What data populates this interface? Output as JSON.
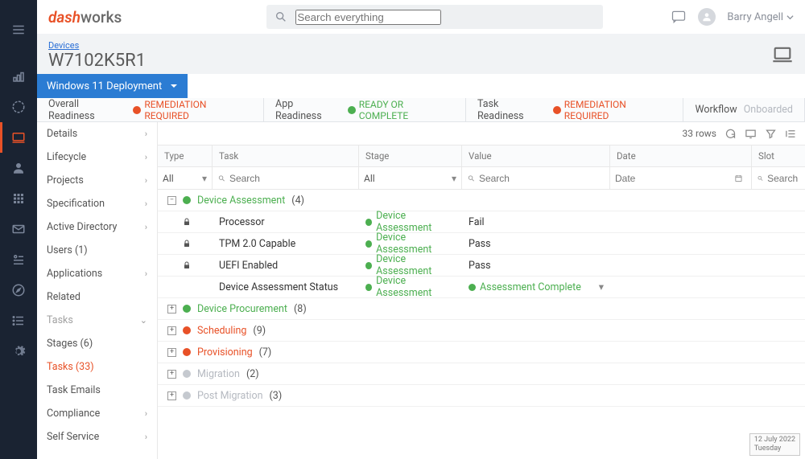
{
  "logo": {
    "prefix": "dash",
    "suffix": "works"
  },
  "search": {
    "placeholder": "Search everything"
  },
  "user": {
    "name": "Barry Angell"
  },
  "breadcrumb": {
    "parent": "Devices",
    "title": "W7102K5R1"
  },
  "deployment_dropdown": "Windows 11 Deployment",
  "tabs": [
    {
      "label": "Overall Readiness",
      "status_text": "REMEDIATION REQUIRED",
      "status_color": "red"
    },
    {
      "label": "App Readiness",
      "status_text": "READY OR COMPLETE",
      "status_color": "green"
    },
    {
      "label": "Task Readiness",
      "status_text": "REMEDIATION REQUIRED",
      "status_color": "red"
    },
    {
      "label": "Workflow",
      "muted_label": "Onboarded"
    }
  ],
  "sidebar": {
    "items": [
      {
        "label": "Details",
        "chevron": true
      },
      {
        "label": "Lifecycle",
        "chevron": true
      },
      {
        "label": "Projects",
        "chevron": true
      },
      {
        "label": "Specification",
        "chevron": true
      },
      {
        "label": "Active Directory",
        "chevron": true
      },
      {
        "label": "Users (1)",
        "chevron": false
      },
      {
        "label": "Applications",
        "chevron": true
      },
      {
        "label": "Related",
        "chevron": false
      },
      {
        "label": "Tasks",
        "chevron": true,
        "muted": true,
        "down": true
      },
      {
        "label": "Stages (6)",
        "chevron": false
      },
      {
        "label": "Tasks (33)",
        "chevron": false,
        "active": true
      },
      {
        "label": "Task Emails",
        "chevron": false
      },
      {
        "label": "Compliance",
        "chevron": true
      },
      {
        "label": "Self Service",
        "chevron": true
      }
    ]
  },
  "grid": {
    "row_count_text": "33 rows",
    "columns": {
      "type": "Type",
      "task": "Task",
      "stage": "Stage",
      "value": "Value",
      "date": "Date",
      "slot": "Slot"
    },
    "filters": {
      "type": "All",
      "task_placeholder": "Search",
      "stage": "All",
      "value_placeholder": "Search",
      "date_placeholder": "Date",
      "slot_placeholder": "Search"
    },
    "groups": [
      {
        "name": "Device Assessment",
        "count": "(4)",
        "color": "green",
        "expanded": true,
        "rows": [
          {
            "locked": true,
            "task": "Processor",
            "stage": "Device Assessment",
            "value": "Fail"
          },
          {
            "locked": true,
            "task": "TPM 2.0 Capable",
            "stage": "Device Assessment",
            "value": "Pass"
          },
          {
            "locked": true,
            "task": "UEFI Enabled",
            "stage": "Device Assessment",
            "value": "Pass"
          },
          {
            "locked": false,
            "task": "Device Assessment Status",
            "stage": "Device Assessment",
            "value": "Assessment Complete",
            "value_green": true,
            "dropdown": true
          }
        ]
      },
      {
        "name": "Device Procurement",
        "count": "(8)",
        "color": "green",
        "expanded": false
      },
      {
        "name": "Scheduling",
        "count": "(9)",
        "color": "red",
        "expanded": false
      },
      {
        "name": "Provisioning",
        "count": "(7)",
        "color": "red",
        "expanded": false
      },
      {
        "name": "Migration",
        "count": "(2)",
        "color": "grey",
        "expanded": false
      },
      {
        "name": "Post Migration",
        "count": "(3)",
        "color": "grey",
        "expanded": false
      }
    ]
  },
  "date_badge": {
    "date": "12 July 2022",
    "day": "Tuesday"
  }
}
